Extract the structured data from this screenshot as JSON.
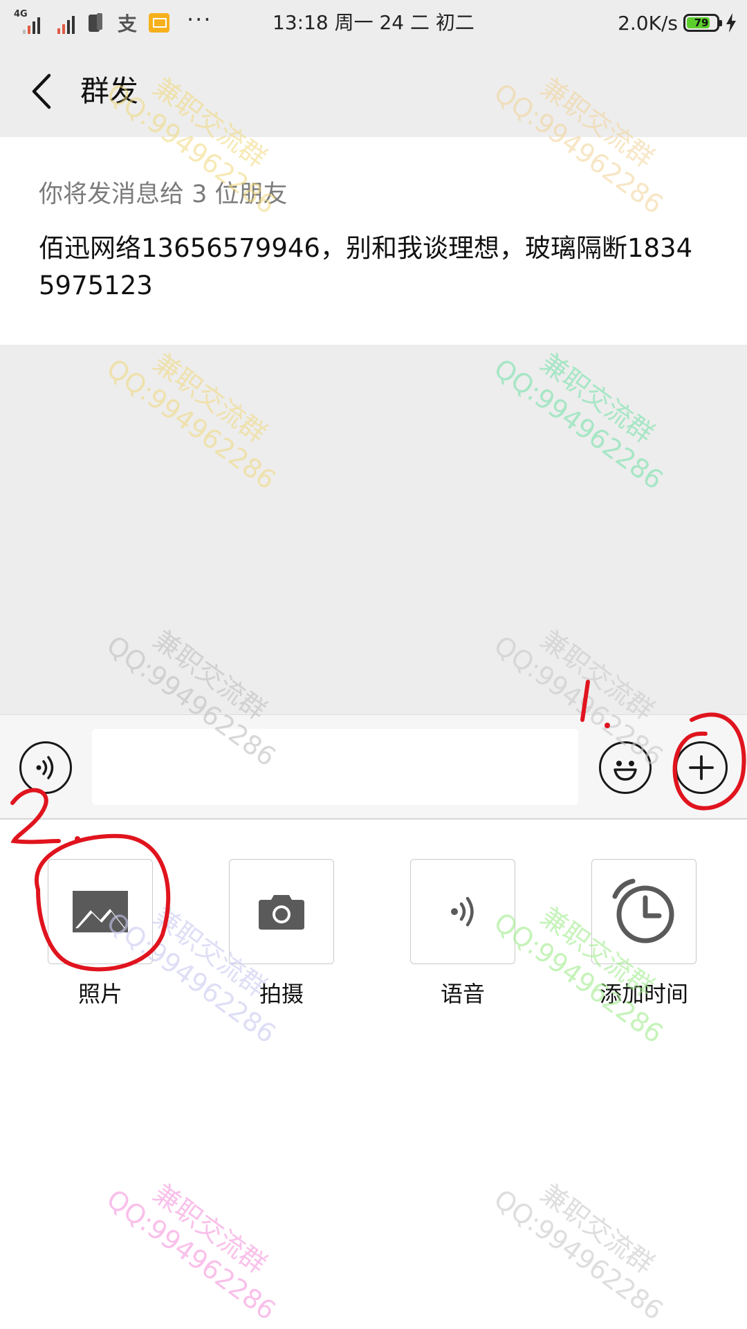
{
  "status_bar": {
    "network_type": "4G",
    "time_date": "13:18 周一 24 二 初二",
    "speed": "2.0K/s",
    "battery_level": "79",
    "icons": [
      "signal-icon",
      "signal-icon",
      "phone-icon",
      "alipay-icon",
      "mail-icon",
      "more-dots-icon",
      "charging-icon"
    ]
  },
  "nav": {
    "title": "群发",
    "back_icon": "chevron-left-icon"
  },
  "recipients": {
    "count_text": "你将发消息给 3 位朋友",
    "names": "佰迅网络13656579946，别和我谈理想，玻璃隔断18345975123"
  },
  "input_bar": {
    "voice_icon": "voice-wave-icon",
    "text_value": "",
    "emoji_icon": "smile-icon",
    "more_icon": "plus-icon"
  },
  "more_panel": {
    "items": [
      {
        "label": "照片",
        "icon": "image-icon"
      },
      {
        "label": "拍摄",
        "icon": "camera-icon"
      },
      {
        "label": "语音",
        "icon": "voice-icon"
      },
      {
        "label": "添加时间",
        "icon": "alarm-clock-icon"
      }
    ]
  },
  "watermark": {
    "line1": "兼职交流群",
    "line2": "QQ:99496​2286"
  },
  "annotations": {
    "step1": "1.",
    "step2": "2.",
    "color": "#e0141e"
  },
  "colors": {
    "nav_bg": "#ededed",
    "panel_bg": "#ffffff",
    "battery": "#5ccf2c"
  }
}
